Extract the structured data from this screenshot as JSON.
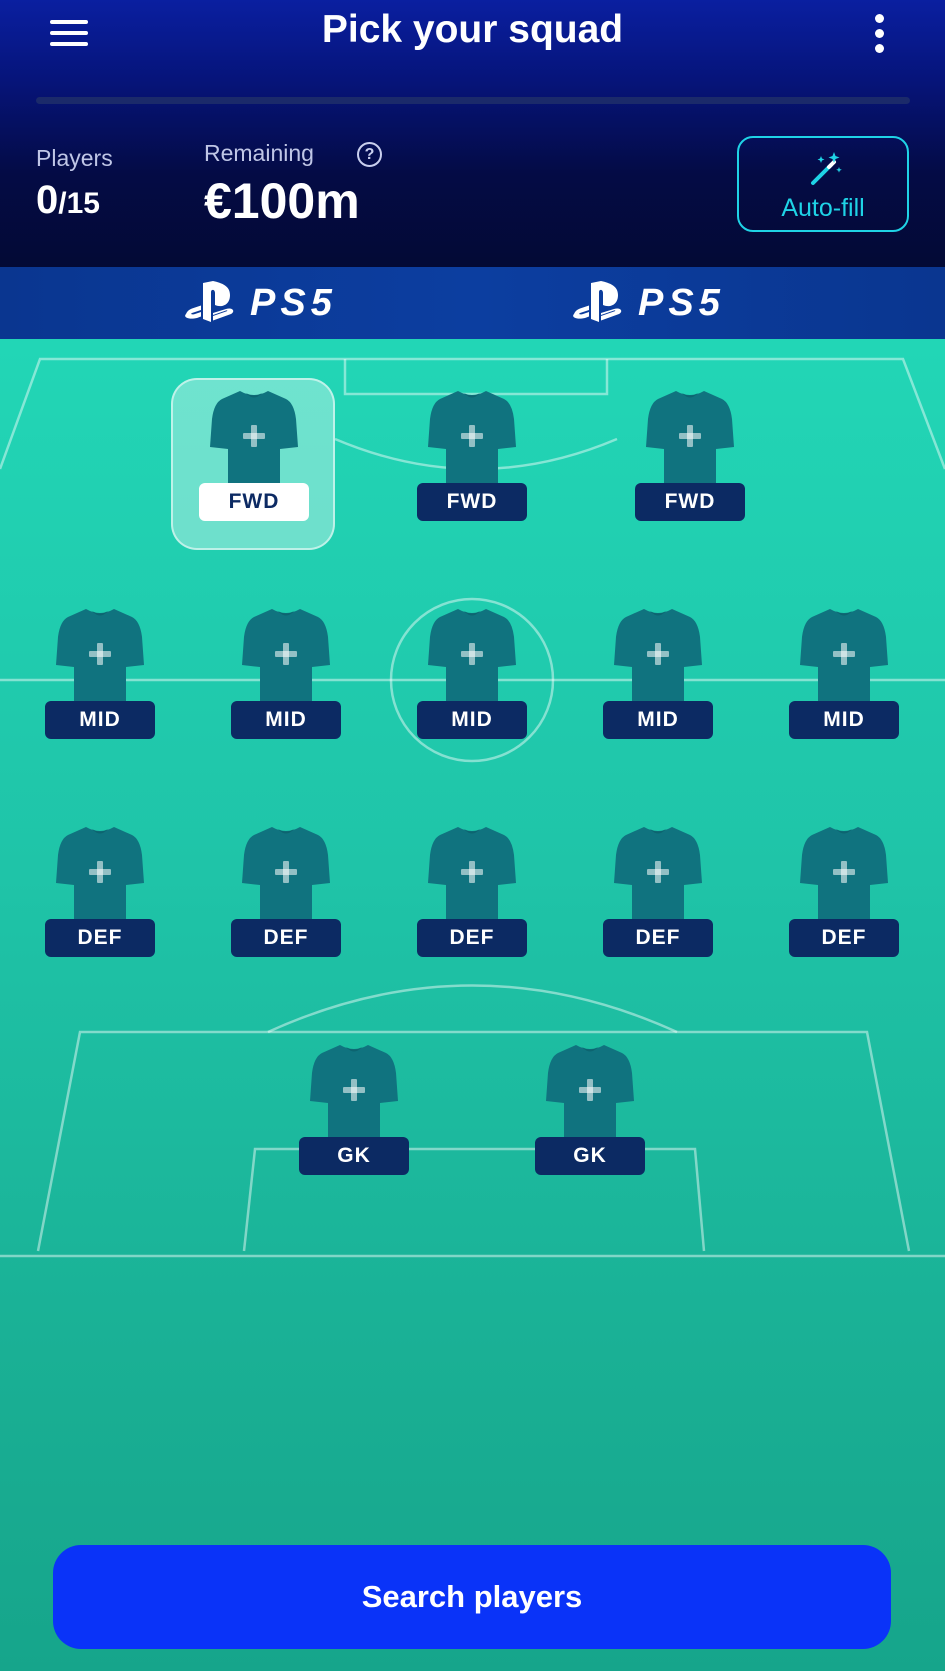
{
  "header": {
    "title": "Pick your squad",
    "menu_icon": "hamburger-menu-icon",
    "more_icon": "more-vertical-icon",
    "progress_fraction": 0
  },
  "stats": {
    "players_label": "Players",
    "players_selected": "0",
    "players_total": "/15",
    "remaining_label": "Remaining",
    "remaining_value": "€100m",
    "help_glyph": "?"
  },
  "autofill": {
    "label": "Auto-fill",
    "icon": "magic-wand-icon"
  },
  "sponsor": {
    "logos": [
      {
        "text": "PS5"
      },
      {
        "text": "PS5"
      }
    ]
  },
  "squad": {
    "forwards": [
      {
        "label": "FWD",
        "selected": true
      },
      {
        "label": "FWD"
      },
      {
        "label": "FWD"
      }
    ],
    "midfielders": [
      {
        "label": "MID"
      },
      {
        "label": "MID"
      },
      {
        "label": "MID"
      },
      {
        "label": "MID"
      },
      {
        "label": "MID"
      }
    ],
    "defenders": [
      {
        "label": "DEF"
      },
      {
        "label": "DEF"
      },
      {
        "label": "DEF"
      },
      {
        "label": "DEF"
      },
      {
        "label": "DEF"
      }
    ],
    "goalkeepers": [
      {
        "label": "GK"
      },
      {
        "label": "GK"
      }
    ]
  },
  "search_button": {
    "label": "Search players"
  },
  "colors": {
    "accent": "#0a33f8",
    "badge": "#0c2a63",
    "shirt": "#10737f",
    "autofill": "#1fd3e6"
  }
}
